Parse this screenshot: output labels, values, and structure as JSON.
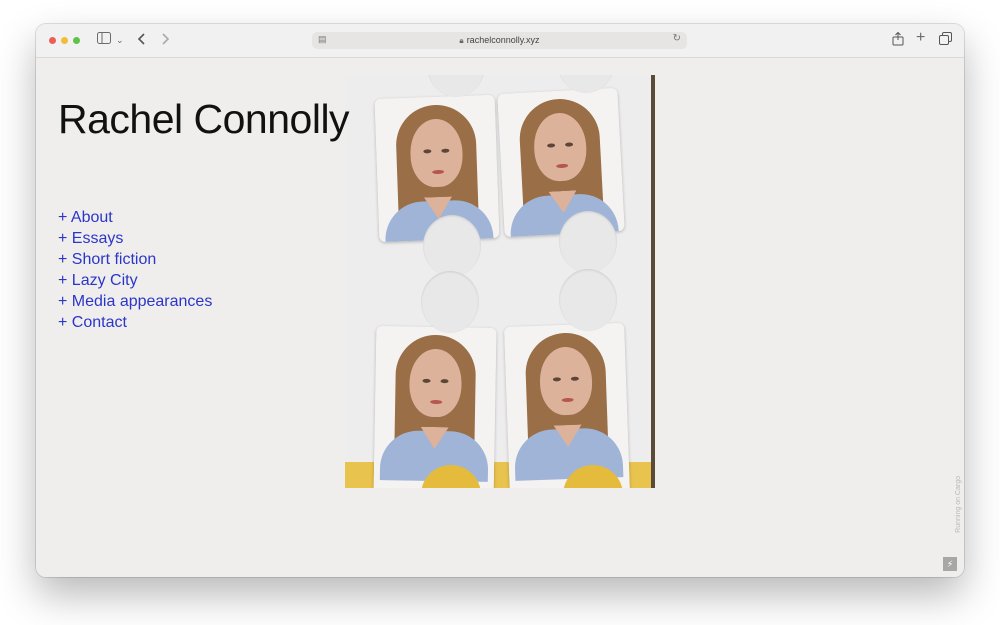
{
  "browser": {
    "url": "rachelconnolly.xyz",
    "lock_icon": "lock-icon",
    "reader_icon": "reader-icon",
    "reload_icon": "reload-icon"
  },
  "site": {
    "title": "Rachel Connolly",
    "nav": [
      {
        "label": "+ About"
      },
      {
        "label": "+ Essays"
      },
      {
        "label": "+ Short fiction"
      },
      {
        "label": "+ Lazy City"
      },
      {
        "label": "+ Media appearances"
      },
      {
        "label": "+ Contact"
      }
    ],
    "link_color": "#2b36c9",
    "photo_alt": "Four passport photos of Rachel Connolly"
  },
  "cargo": {
    "label": "Running on Cargo"
  }
}
